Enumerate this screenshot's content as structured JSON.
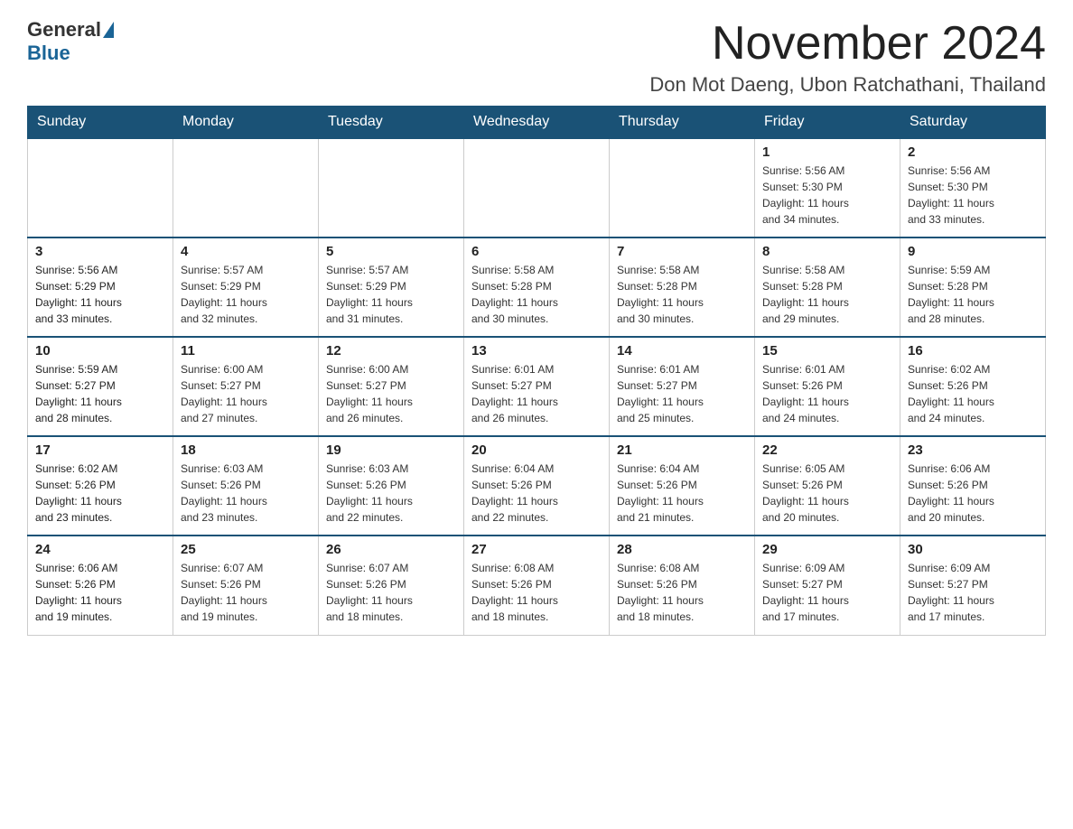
{
  "logo": {
    "general": "General",
    "blue": "Blue"
  },
  "header": {
    "title": "November 2024",
    "location": "Don Mot Daeng, Ubon Ratchathani, Thailand"
  },
  "days_of_week": [
    "Sunday",
    "Monday",
    "Tuesday",
    "Wednesday",
    "Thursday",
    "Friday",
    "Saturday"
  ],
  "weeks": [
    [
      {
        "day": "",
        "info": ""
      },
      {
        "day": "",
        "info": ""
      },
      {
        "day": "",
        "info": ""
      },
      {
        "day": "",
        "info": ""
      },
      {
        "day": "",
        "info": ""
      },
      {
        "day": "1",
        "info": "Sunrise: 5:56 AM\nSunset: 5:30 PM\nDaylight: 11 hours\nand 34 minutes."
      },
      {
        "day": "2",
        "info": "Sunrise: 5:56 AM\nSunset: 5:30 PM\nDaylight: 11 hours\nand 33 minutes."
      }
    ],
    [
      {
        "day": "3",
        "info": "Sunrise: 5:56 AM\nSunset: 5:29 PM\nDaylight: 11 hours\nand 33 minutes."
      },
      {
        "day": "4",
        "info": "Sunrise: 5:57 AM\nSunset: 5:29 PM\nDaylight: 11 hours\nand 32 minutes."
      },
      {
        "day": "5",
        "info": "Sunrise: 5:57 AM\nSunset: 5:29 PM\nDaylight: 11 hours\nand 31 minutes."
      },
      {
        "day": "6",
        "info": "Sunrise: 5:58 AM\nSunset: 5:28 PM\nDaylight: 11 hours\nand 30 minutes."
      },
      {
        "day": "7",
        "info": "Sunrise: 5:58 AM\nSunset: 5:28 PM\nDaylight: 11 hours\nand 30 minutes."
      },
      {
        "day": "8",
        "info": "Sunrise: 5:58 AM\nSunset: 5:28 PM\nDaylight: 11 hours\nand 29 minutes."
      },
      {
        "day": "9",
        "info": "Sunrise: 5:59 AM\nSunset: 5:28 PM\nDaylight: 11 hours\nand 28 minutes."
      }
    ],
    [
      {
        "day": "10",
        "info": "Sunrise: 5:59 AM\nSunset: 5:27 PM\nDaylight: 11 hours\nand 28 minutes."
      },
      {
        "day": "11",
        "info": "Sunrise: 6:00 AM\nSunset: 5:27 PM\nDaylight: 11 hours\nand 27 minutes."
      },
      {
        "day": "12",
        "info": "Sunrise: 6:00 AM\nSunset: 5:27 PM\nDaylight: 11 hours\nand 26 minutes."
      },
      {
        "day": "13",
        "info": "Sunrise: 6:01 AM\nSunset: 5:27 PM\nDaylight: 11 hours\nand 26 minutes."
      },
      {
        "day": "14",
        "info": "Sunrise: 6:01 AM\nSunset: 5:27 PM\nDaylight: 11 hours\nand 25 minutes."
      },
      {
        "day": "15",
        "info": "Sunrise: 6:01 AM\nSunset: 5:26 PM\nDaylight: 11 hours\nand 24 minutes."
      },
      {
        "day": "16",
        "info": "Sunrise: 6:02 AM\nSunset: 5:26 PM\nDaylight: 11 hours\nand 24 minutes."
      }
    ],
    [
      {
        "day": "17",
        "info": "Sunrise: 6:02 AM\nSunset: 5:26 PM\nDaylight: 11 hours\nand 23 minutes."
      },
      {
        "day": "18",
        "info": "Sunrise: 6:03 AM\nSunset: 5:26 PM\nDaylight: 11 hours\nand 23 minutes."
      },
      {
        "day": "19",
        "info": "Sunrise: 6:03 AM\nSunset: 5:26 PM\nDaylight: 11 hours\nand 22 minutes."
      },
      {
        "day": "20",
        "info": "Sunrise: 6:04 AM\nSunset: 5:26 PM\nDaylight: 11 hours\nand 22 minutes."
      },
      {
        "day": "21",
        "info": "Sunrise: 6:04 AM\nSunset: 5:26 PM\nDaylight: 11 hours\nand 21 minutes."
      },
      {
        "day": "22",
        "info": "Sunrise: 6:05 AM\nSunset: 5:26 PM\nDaylight: 11 hours\nand 20 minutes."
      },
      {
        "day": "23",
        "info": "Sunrise: 6:06 AM\nSunset: 5:26 PM\nDaylight: 11 hours\nand 20 minutes."
      }
    ],
    [
      {
        "day": "24",
        "info": "Sunrise: 6:06 AM\nSunset: 5:26 PM\nDaylight: 11 hours\nand 19 minutes."
      },
      {
        "day": "25",
        "info": "Sunrise: 6:07 AM\nSunset: 5:26 PM\nDaylight: 11 hours\nand 19 minutes."
      },
      {
        "day": "26",
        "info": "Sunrise: 6:07 AM\nSunset: 5:26 PM\nDaylight: 11 hours\nand 18 minutes."
      },
      {
        "day": "27",
        "info": "Sunrise: 6:08 AM\nSunset: 5:26 PM\nDaylight: 11 hours\nand 18 minutes."
      },
      {
        "day": "28",
        "info": "Sunrise: 6:08 AM\nSunset: 5:26 PM\nDaylight: 11 hours\nand 18 minutes."
      },
      {
        "day": "29",
        "info": "Sunrise: 6:09 AM\nSunset: 5:27 PM\nDaylight: 11 hours\nand 17 minutes."
      },
      {
        "day": "30",
        "info": "Sunrise: 6:09 AM\nSunset: 5:27 PM\nDaylight: 11 hours\nand 17 minutes."
      }
    ]
  ]
}
